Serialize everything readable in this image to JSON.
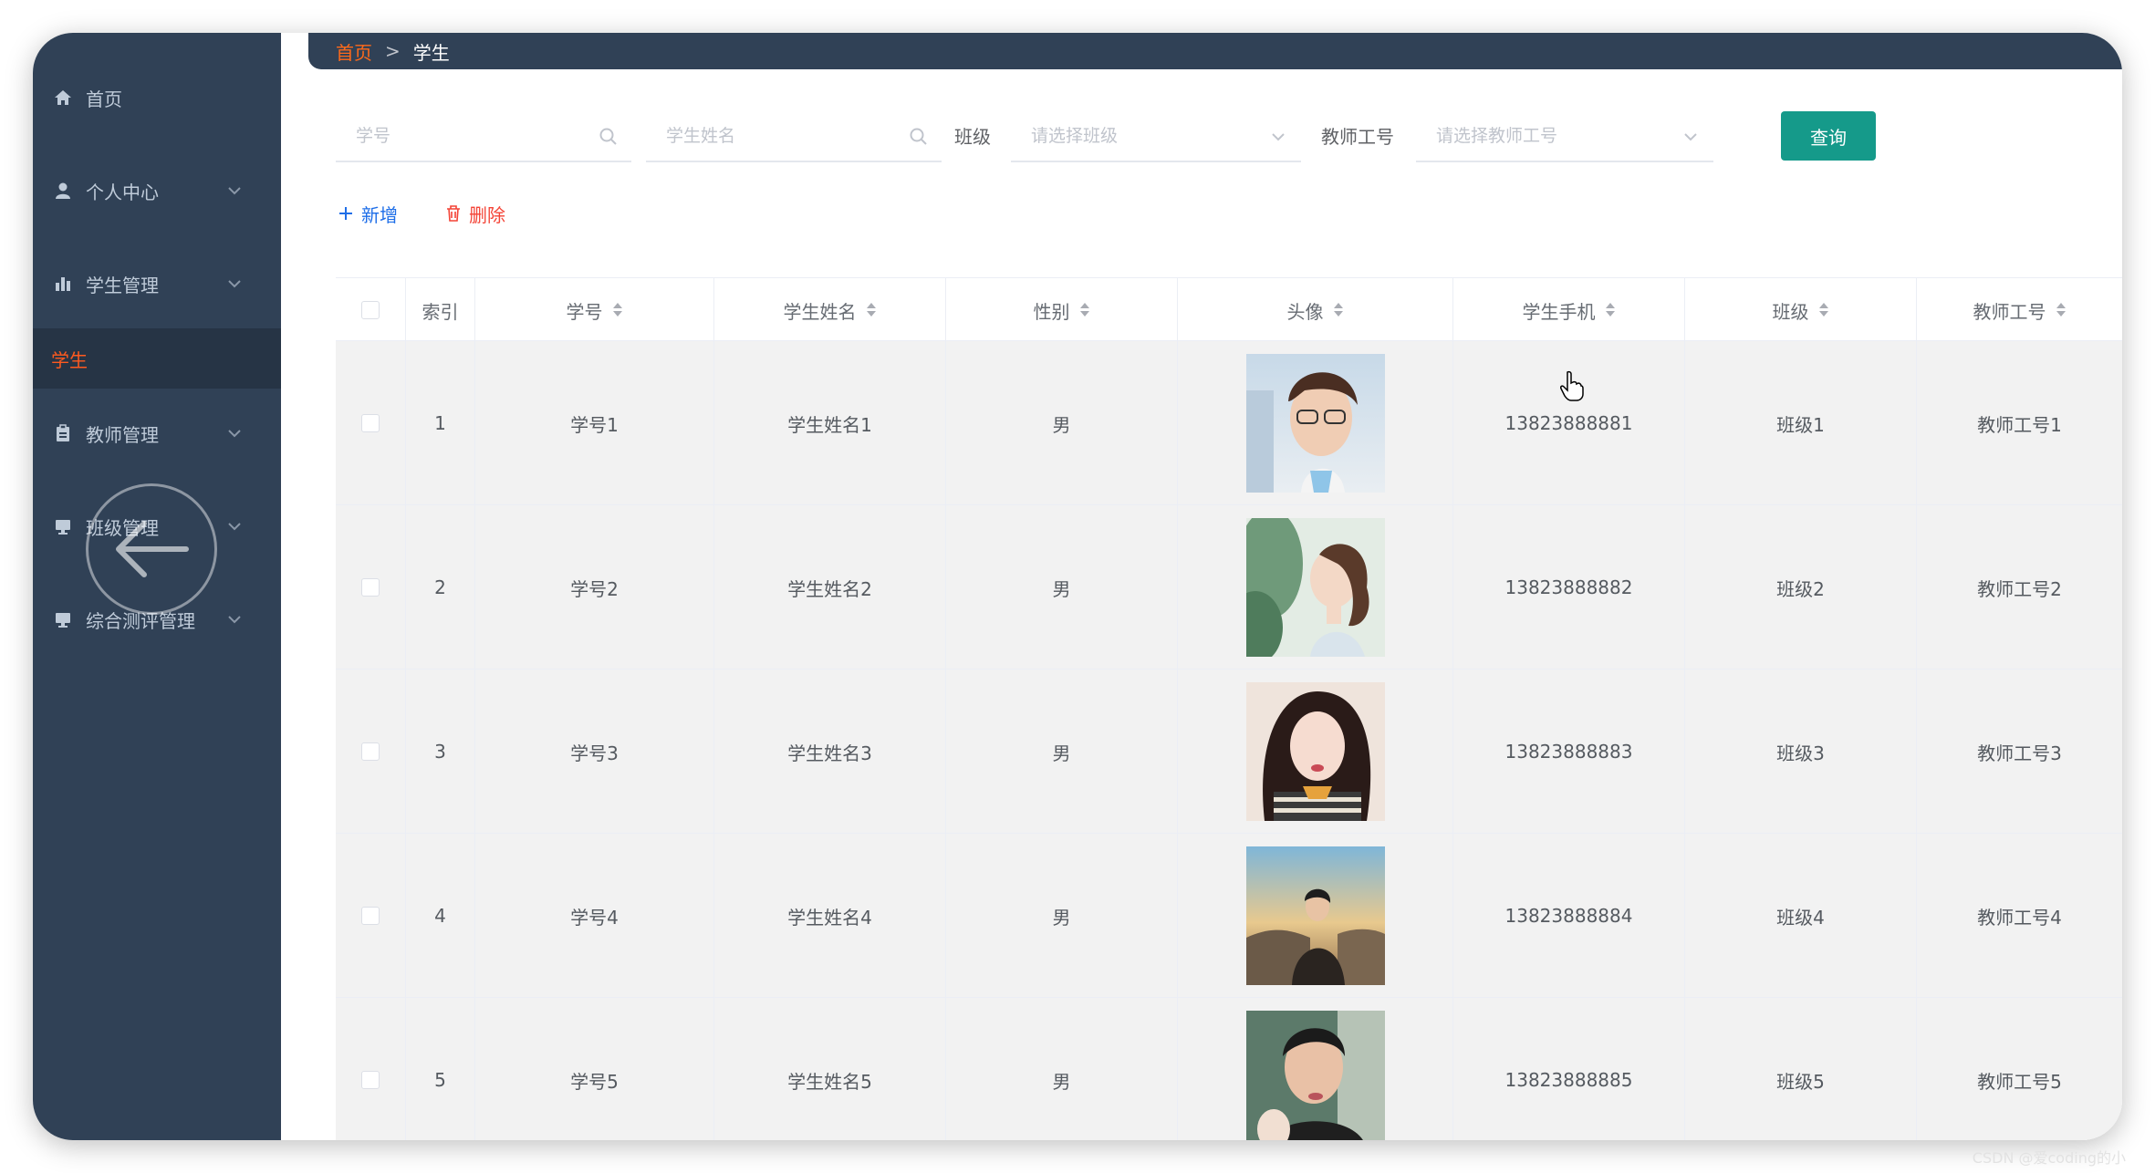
{
  "sidebar": {
    "items": [
      {
        "label": "首页",
        "icon": "home-icon",
        "has_chevron": false
      },
      {
        "label": "个人中心",
        "icon": "user-icon",
        "has_chevron": true
      },
      {
        "label": "学生管理",
        "icon": "bar-chart-icon",
        "has_chevron": true
      },
      {
        "label": "学生",
        "icon": "",
        "has_chevron": false,
        "active": true
      },
      {
        "label": "教师管理",
        "icon": "clipboard-icon",
        "has_chevron": true
      },
      {
        "label": "班级管理",
        "icon": "monitor-icon",
        "has_chevron": true
      },
      {
        "label": "综合测评管理",
        "icon": "monitor-icon",
        "has_chevron": true
      }
    ]
  },
  "breadcrumb": {
    "home": "首页",
    "separator": ">",
    "current": "学生"
  },
  "search": {
    "student_no_placeholder": "学号",
    "student_name_placeholder": "学生姓名",
    "class_label": "班级",
    "class_placeholder": "请选择班级",
    "teacher_label": "教师工号",
    "teacher_placeholder": "请选择教师工号",
    "query_button": "查询"
  },
  "actions": {
    "add": "新增",
    "delete": "删除"
  },
  "table": {
    "headers": [
      "索引",
      "学号",
      "学生姓名",
      "性别",
      "头像",
      "学生手机",
      "班级",
      "教师工号"
    ],
    "rows": [
      {
        "index": "1",
        "student_no": "学号1",
        "name": "学生姓名1",
        "gender": "男",
        "phone": "13823888881",
        "class": "班级1",
        "teacher_no": "教师工号1"
      },
      {
        "index": "2",
        "student_no": "学号2",
        "name": "学生姓名2",
        "gender": "男",
        "phone": "13823888882",
        "class": "班级2",
        "teacher_no": "教师工号2"
      },
      {
        "index": "3",
        "student_no": "学号3",
        "name": "学生姓名3",
        "gender": "男",
        "phone": "13823888883",
        "class": "班级3",
        "teacher_no": "教师工号3"
      },
      {
        "index": "4",
        "student_no": "学号4",
        "name": "学生姓名4",
        "gender": "男",
        "phone": "13823888884",
        "class": "班级4",
        "teacher_no": "教师工号4"
      },
      {
        "index": "5",
        "student_no": "学号5",
        "name": "学生姓名5",
        "gender": "男",
        "phone": "13823888885",
        "class": "班级5",
        "teacher_no": "教师工号5"
      }
    ]
  },
  "colors": {
    "sidebar_bg": "#304156",
    "active_menu": "#ff5a1f",
    "primary": "#159a8a",
    "add": "#1e6ee8",
    "delete": "#f44336"
  },
  "watermark": "CSDN @爱coding的小"
}
